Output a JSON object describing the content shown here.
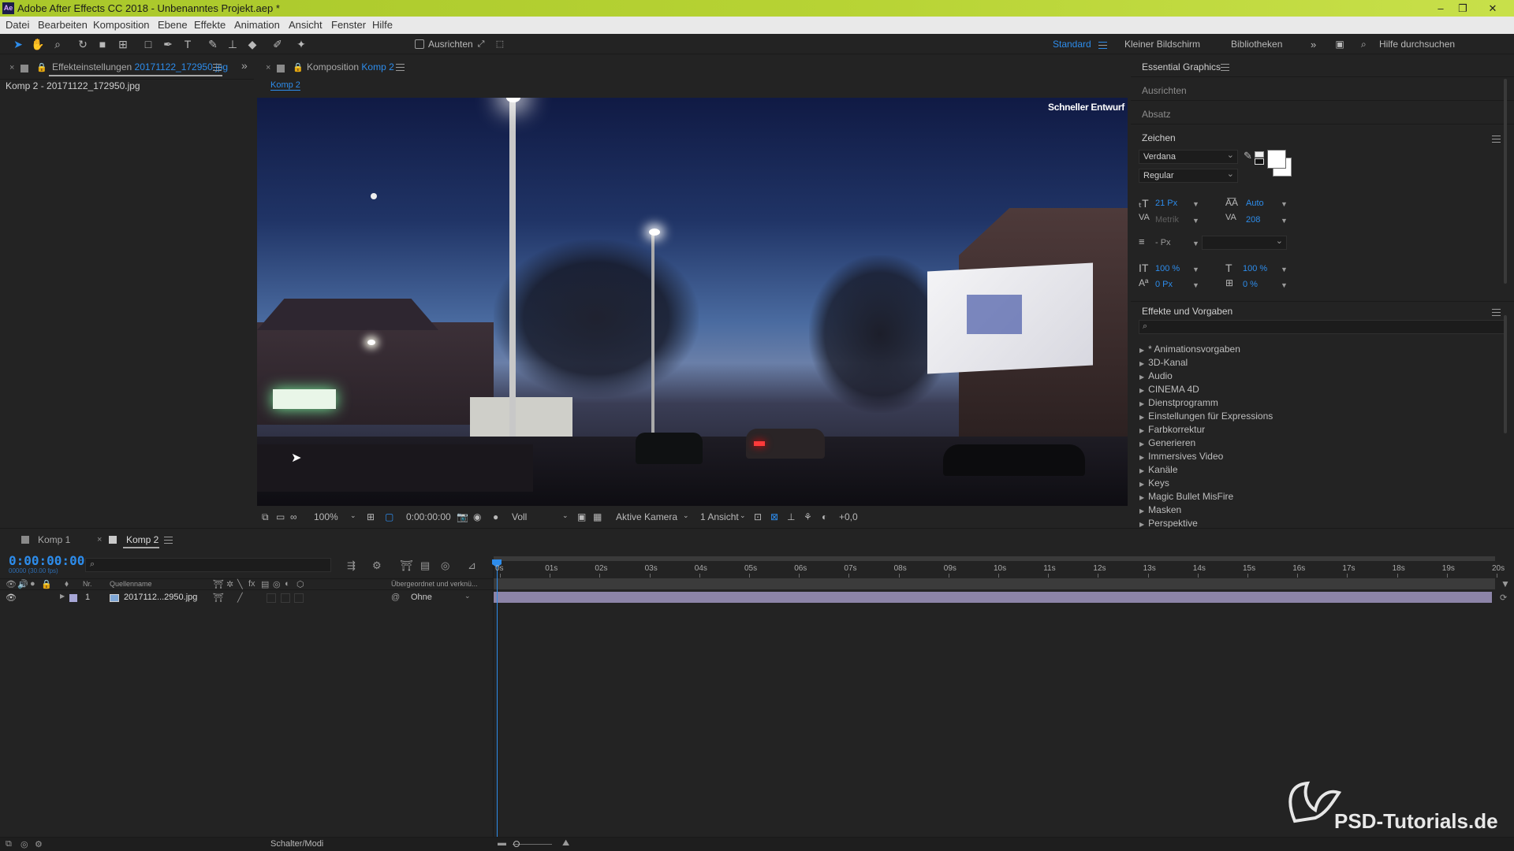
{
  "app": {
    "title": "Adobe After Effects CC 2018 - Unbenanntes Projekt.aep *",
    "logo": "Ae",
    "window_controls": {
      "minimize": "–",
      "maximize": "❐",
      "close": "✕"
    }
  },
  "menu": [
    "Datei",
    "Bearbeiten",
    "Komposition",
    "Ebene",
    "Effekte",
    "Animation",
    "Ansicht",
    "Fenster",
    "Hilfe"
  ],
  "toolbar": {
    "tools": [
      "selection-tool",
      "hand-tool",
      "zoom-tool",
      "rotate-tool",
      "camera-tool",
      "pan-behind-tool",
      "rectangle-tool",
      "pen-tool",
      "type-tool",
      "brush-tool",
      "clone-stamp-tool",
      "eraser-tool",
      "roto-brush-tool",
      "puppet-tool"
    ],
    "align_label": "Ausrichten",
    "workspaces": [
      "Standard",
      "Kleiner Bildschirm",
      "Bibliotheken"
    ],
    "active_workspace": "Standard",
    "search_placeholder": "Hilfe durchsuchen"
  },
  "effect_controls": {
    "tab_prefix": "Effekteinstellungen",
    "tab_file": "20171122_172950.jpg",
    "layer_label": "Komp 2 - 20171122_172950.jpg"
  },
  "composition": {
    "tab_prefix": "Komposition",
    "tab_name": "Komp 2",
    "breadcrumb": "Komp 2",
    "draft_label": "Schneller Entwurf",
    "viewer_bar": {
      "zoom": "100%",
      "timecode": "0:00:00:00",
      "resolution": "Voll",
      "camera": "Aktive Kamera",
      "views": "1 Ansicht",
      "exposure": "+0,0"
    }
  },
  "essential_graphics": {
    "title": "Essential Graphics",
    "sections": [
      "Ausrichten",
      "Absatz"
    ],
    "character": {
      "title": "Zeichen",
      "font": "Verdana",
      "style": "Regular",
      "size": "21 Px",
      "leading": "Auto",
      "kerning": "Metrik",
      "tracking": "208",
      "stroke_width": "- Px",
      "vert_scale": "100 %",
      "horiz_scale": "100 %",
      "baseline": "0 Px",
      "tsume": "0 %",
      "fill_color": "#ffffff",
      "stroke_color": "#ffffff"
    }
  },
  "effects_presets": {
    "title": "Effekte und Vorgaben",
    "search_placeholder": "",
    "items": [
      "* Animationsvorgaben",
      "3D-Kanal",
      "Audio",
      "CINEMA 4D",
      "Dienstprogramm",
      "Einstellungen für Expressions",
      "Farbkorrektur",
      "Generieren",
      "Immersives Video",
      "Kanäle",
      "Keys",
      "Magic Bullet MisFire",
      "Masken",
      "Perspektive"
    ]
  },
  "timeline": {
    "tabs": [
      "Komp 1",
      "Komp 2"
    ],
    "active_tab": "Komp 2",
    "timecode": "0:00:00:00",
    "timecode_sub": "00000 (30.00 fps)",
    "columns": {
      "nr": "Nr.",
      "source": "Quellenname",
      "parent": "Übergeordnet und verknü..."
    },
    "layers": [
      {
        "nr": "1",
        "name": "2017112...2950.jpg",
        "parent": "Ohne"
      }
    ],
    "ruler": [
      "0s",
      "01s",
      "02s",
      "03s",
      "04s",
      "05s",
      "06s",
      "07s",
      "08s",
      "09s",
      "10s",
      "11s",
      "12s",
      "13s",
      "14s",
      "15s",
      "16s",
      "17s",
      "18s",
      "19s",
      "20s"
    ],
    "footer_label": "Schalter/Modi"
  },
  "watermark": "PSD-Tutorials.de",
  "colors": {
    "accent": "#2d8ceb",
    "title_bar": "#b7d334",
    "layer_bar": "#8c84a8",
    "panel_bg": "#232323"
  }
}
